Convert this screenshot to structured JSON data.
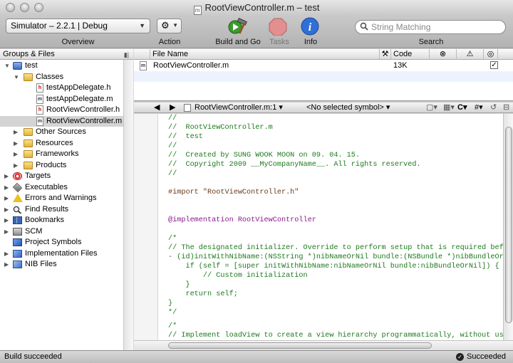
{
  "window": {
    "title": "RootViewController.m – test",
    "doc_icon_letter": "m"
  },
  "toolbar": {
    "overview_value": "Simulator – 2.2.1 | Debug",
    "overview_label": "Overview",
    "action_label": "Action",
    "build_label": "Build and Go",
    "tasks_label": "Tasks",
    "info_label": "Info",
    "search_placeholder": "String Matching",
    "search_label": "Search"
  },
  "sidebar": {
    "header": "Groups & Files",
    "items": [
      {
        "label": "test",
        "icon": "project-icon"
      },
      {
        "label": "Classes",
        "icon": "folder-icon"
      },
      {
        "label": "testAppDelegate.h",
        "icon": "header-file-icon",
        "icon_letter": "h"
      },
      {
        "label": "testAppDelegate.m",
        "icon": "source-file-icon",
        "icon_letter": "m"
      },
      {
        "label": "RootViewController.h",
        "icon": "header-file-icon",
        "icon_letter": "h"
      },
      {
        "label": "RootViewController.m",
        "icon": "source-file-icon",
        "icon_letter": "m"
      },
      {
        "label": "Other Sources",
        "icon": "folder-icon"
      },
      {
        "label": "Resources",
        "icon": "folder-icon"
      },
      {
        "label": "Frameworks",
        "icon": "folder-icon"
      },
      {
        "label": "Products",
        "icon": "folder-icon"
      },
      {
        "label": "Targets",
        "icon": "target-icon"
      },
      {
        "label": "Executables",
        "icon": "executables-icon"
      },
      {
        "label": "Errors and Warnings",
        "icon": "warning-icon"
      },
      {
        "label": "Find Results",
        "icon": "magnifier-icon"
      },
      {
        "label": "Bookmarks",
        "icon": "bookmarks-icon"
      },
      {
        "label": "SCM",
        "icon": "scm-icon"
      },
      {
        "label": "Project Symbols",
        "icon": "symbols-icon"
      },
      {
        "label": "Implementation Files",
        "icon": "implementation-files-icon"
      },
      {
        "label": "NIB Files",
        "icon": "nib-files-icon"
      }
    ]
  },
  "file_list": {
    "columns": {
      "file_name": "File Name",
      "code": "Code"
    },
    "rows": [
      {
        "name": "RootViewController.m",
        "icon_letter": "m",
        "code": "13K",
        "checked": true
      }
    ]
  },
  "nav_bar": {
    "file": "RootViewController.m:1",
    "symbol": "<No selected symbol>",
    "lang": "C"
  },
  "code_lines": [
    "//",
    "//  RootViewController.m",
    "//  test",
    "//",
    "//  Created by SUNG WOOK MOON on 09. 04. 15.",
    "//  Copyright 2009 __MyCompanyName__. All rights reserved.",
    "//",
    "",
    "#import \"RootViewController.h\"",
    "",
    "",
    "@implementation RootViewController",
    "",
    "/*",
    "// The designated initializer. Override to perform setup that is required before the v",
    "- (id)initWithNibName:(NSString *)nibNameOrNil bundle:(NSBundle *)nibBundleOrNil {",
    "    if (self = [super initWithNibName:nibNameOrNil bundle:nibBundleOrNil]) {",
    "        // Custom initialization",
    "    }",
    "    return self;",
    "}",
    "*/",
    "",
    "",
    "/*",
    "// Implement loadView to create a view hierarchy programmatically, without using a nib"
  ],
  "status": {
    "left": "Build succeeded",
    "right": "Succeeded"
  }
}
